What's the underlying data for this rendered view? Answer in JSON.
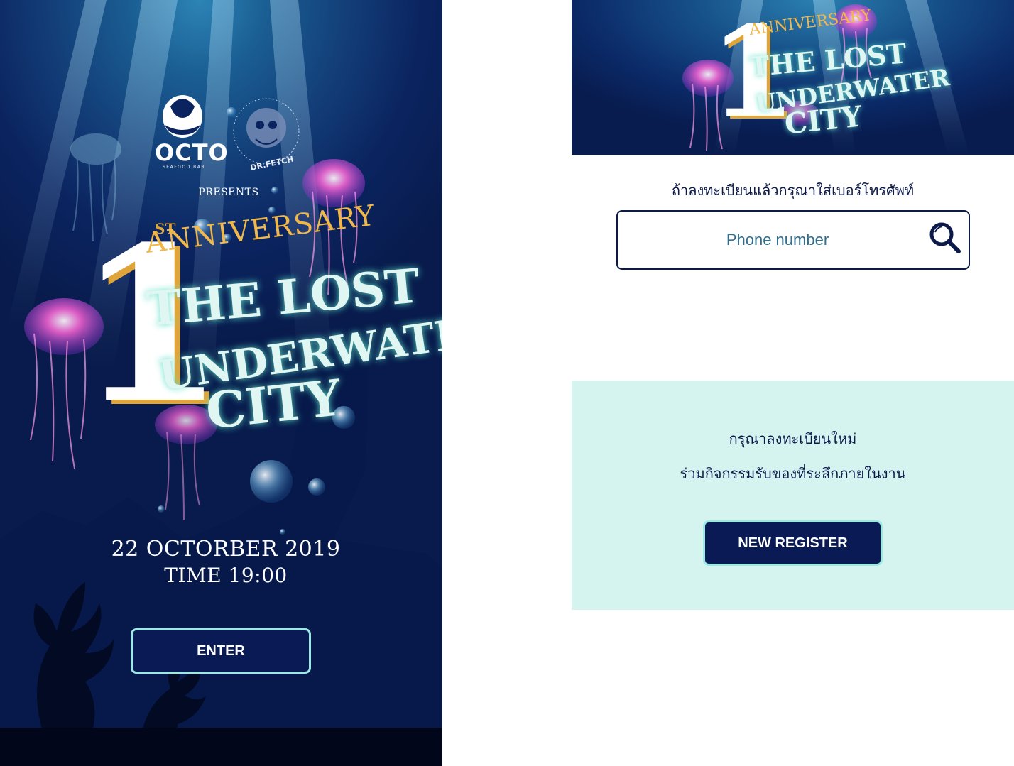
{
  "colors": {
    "deep_ocean": "#0b2460",
    "button_fill": "#0a1a55",
    "button_border": "#9be8e4",
    "register_panel_bg": "#d5f4ef",
    "text_navy": "#0c1a4a",
    "placeholder_teal": "#2f6e8c",
    "title_gold": "#e0a53a",
    "title_glow": "#5de0c8"
  },
  "landing": {
    "brand_octo": "OCTO",
    "brand_octo_sub": "SEAFOOD BAR",
    "brand_fetch": "DR.FETCH",
    "presents": "PRESENTS",
    "title": {
      "number": "1",
      "suffix": "ST",
      "anniversary": "ANNIVERSARY",
      "line_lost": "THE LOST",
      "line_underwater": "UNDERWATER",
      "line_city": "CITY"
    },
    "date": "22 OCTORBER 2019",
    "time": "TIME 19:00",
    "enter_label": "ENTER"
  },
  "lookup": {
    "instruction": "ถ้าลงทะเบียนแล้วกรุณาใส่เบอร์โทรศัพท์",
    "phone_placeholder": "Phone number",
    "phone_value": "",
    "search_icon": "magnifier-icon"
  },
  "register": {
    "line1": "กรุณาลงทะเบียนใหม่",
    "line2": "ร่วมกิจกรรมรับของที่ระลึกภายในงาน",
    "button_label": "NEW REGISTER"
  }
}
